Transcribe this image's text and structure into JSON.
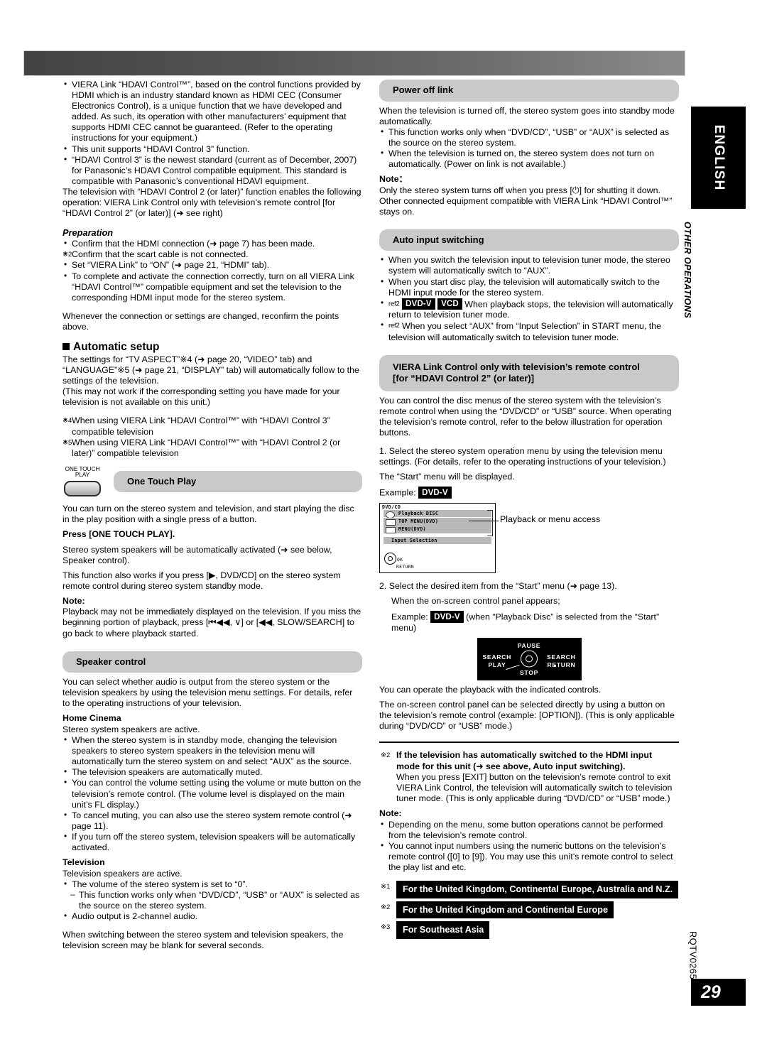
{
  "header": {
    "banner": ""
  },
  "margin": {
    "language_tab": "ENGLISH",
    "section_label": "OTHER OPERATIONS",
    "doc_code": "RQTV0265",
    "page_number": "29"
  },
  "left_column": {
    "intro_bullets": [
      "VIERA Link “HDAVI Control™”, based on the control functions provided by HDMI which is an industry standard known as HDMI CEC (Consumer Electronics Control), is a unique function that we have developed and added. As such, its operation with other manufacturers’ equipment that supports HDMI CEC cannot be guaranteed. (Refer to the operating instructions for your equipment.)",
      "This unit supports “HDAVI Control 3” function."
    ],
    "hdavi3_note": "“HDAVI Control 3” is the newest standard (current as of December, 2007) for Panasonic’s HDAVI Control compatible equipment. This standard is compatible with Panasonic’s conventional HDAVI equipment.",
    "tv_function_para": "The television with “HDAVI Control 2 (or later)” function enables the following operation: VIERA Link Control only with television’s remote control [for “HDAVI Control 2” (or later)] (➜ see right)",
    "preparation_heading": "Preparation",
    "preparation_items": [
      {
        "mark": "bullet",
        "text": "Confirm that the HDMI connection (➜ page 7) has been made."
      },
      {
        "mark": "※2",
        "text": "Confirm that the scart cable is not connected."
      },
      {
        "mark": "bullet",
        "text": "Set “VIERA Link” to “ON” (➜ page 21, “HDMI” tab)."
      },
      {
        "mark": "bullet",
        "text": "To complete and activate the connection correctly, turn on all VIERA Link “HDAVI Control™” compatible equipment and set the television to the corresponding HDMI input mode for the stereo system."
      }
    ],
    "reconfirm_para": "Whenever the connection or settings are changed, reconfirm the points above.",
    "automatic_setup": {
      "heading": "Automatic setup",
      "para1": "The settings for “TV ASPECT”※4 (➜ page 20, “VIDEO” tab) and “LANGUAGE”※5 (➜ page 21, “DISPLAY” tab) will automatically follow to the settings of the television.",
      "para2": "(This may not work if the corresponding setting you have made for your television is not available on this unit.)",
      "footnotes": [
        {
          "mark": "※4",
          "text": "When using VIERA Link “HDAVI Control™” with “HDAVI Control 3” compatible television"
        },
        {
          "mark": "※5",
          "text": "When using VIERA Link “HDAVI Control™” with “HDAVI Control 2 (or later)” compatible television"
        }
      ]
    },
    "one_touch_play": {
      "button_label_line1": "ONE TOUCH",
      "button_label_line2": "PLAY",
      "heading": "One Touch Play",
      "para1": "You can turn on the stereo system and television, and start playing the disc in the play position with a single press of a button.",
      "press_label": "Press [ONE TOUCH PLAY].",
      "para2": "Stereo system speakers will be automatically activated (➜ see below, Speaker control).",
      "para3": "This function also works if you press [▶, DVD/CD] on the stereo system remote control during stereo system standby mode.",
      "note_label": "Note:",
      "note_text": "Playback may not be immediately displayed on the television. If you miss the beginning portion of playback, press [⏮◀◀, ∨] or [◀◀, SLOW/SEARCH] to go back to where playback started."
    },
    "speaker_control": {
      "heading": "Speaker control",
      "intro": "You can select whether audio is output from the stereo system or the television speakers by using the television menu settings. For details, refer to the operating instructions of your television.",
      "home_cinema": {
        "heading": "Home Cinema",
        "lead": "Stereo system speakers are active.",
        "bullets": [
          "When the stereo system is in standby mode, changing the television speakers to stereo system speakers in the television menu will automatically turn the stereo system on and select “AUX” as the source.",
          "The television speakers are automatically muted.",
          "You can control the volume setting using the volume or mute button on the television’s remote control. (The volume level is displayed on the main unit’s FL display.)",
          "To cancel muting, you can also use the stereo system remote control (➜ page 11).",
          "If you turn off the stereo system, television speakers will be automatically activated."
        ]
      },
      "television": {
        "heading": "Television",
        "lead": "Television speakers are active.",
        "bullet1": "The volume of the stereo system is set to “0”.",
        "subbullet1": "This function works only when “DVD/CD”, “USB” or “AUX” is selected as the source on the stereo system.",
        "bullet2": "Audio output is 2-channel audio."
      },
      "closing": "When switching between the stereo system and television speakers, the television screen may be blank for several seconds."
    }
  },
  "right_column": {
    "power_off_link": {
      "heading": "Power off link",
      "intro": "When the television is turned off, the stereo system goes into standby mode automatically.",
      "bullets": [
        "This function works only when “DVD/CD”, “USB” or “AUX” is selected as the source on the stereo system.",
        "When the television is turned on, the stereo system does not turn on automatically. (Power on link is not available.)"
      ],
      "note_label": "Note：",
      "note_text": "Only the stereo system turns off when you press [⏻] for shutting it down. Other connected equipment compatible with VIERA Link “HDAVI Control™” stays on."
    },
    "auto_input_switching": {
      "heading": "Auto input switching",
      "bullets": [
        {
          "mark": "bullet",
          "text": "When you switch the television input to television tuner mode, the stereo system will automatically switch to “AUX”."
        },
        {
          "mark": "bullet",
          "text": "When you start disc play, the television will automatically switch to the HDMI input mode for the stereo system."
        },
        {
          "mark": "ref2",
          "badges": [
            "DVD-V",
            "VCD"
          ],
          "text": "When playback stops, the television will automatically return to television tuner mode."
        },
        {
          "mark": "ref2",
          "text": "When you select “AUX” from “Input Selection” in START menu, the television will automatically switch to television tuner mode."
        }
      ]
    },
    "viera_link_control": {
      "heading_line1": "VIERA Link Control only with television’s remote control",
      "heading_line2": "[for “HDAVI Control 2” (or later)]",
      "intro": "You can control the disc menus of the stereo system with the television’s remote control when using the “DVD/CD” or “USB” source. When operating the television’s remote control, refer to the below illustration for operation buttons.",
      "step1": "1. Select the stereo system operation menu by using the television menu settings. (For details, refer to the operating instructions of your television.)",
      "step1_result": "The “Start” menu will be displayed.",
      "example_label": "Example:",
      "example_badge": "DVD-V",
      "tv_menu": {
        "title": "DVD/CD",
        "rows": [
          {
            "label": "Playback DISC",
            "icon": "disc-icon"
          },
          {
            "label": "TOP MENU(DVD)",
            "icon": "menu-icon"
          },
          {
            "label": "MENU(DVD)",
            "icon": "menu-icon"
          }
        ],
        "extra_row": "Input Selection",
        "footer_line1": "OK",
        "footer_line2": "RETURN"
      },
      "callout": "Playback or menu access",
      "step2": "2. Select the desired item from the “Start” menu (➜ page 13).",
      "step2_sub": "When the on-screen control panel appears;",
      "step2_example_label": "Example:",
      "step2_example_badge": "DVD-V",
      "step2_example_rest": "(when “Playback Disc” is selected from the “Start” menu)",
      "osd_panel": {
        "pause": "PAUSE",
        "search_left": "SEARCH",
        "search_right": "SEARCH",
        "play": "PLAY",
        "return": "RETURN",
        "stop": "STOP"
      },
      "after1": "You can operate the playback with the indicated controls.",
      "after2": "The on-screen control panel can be selected directly by using a button on the television’s remote control (example: [OPTION]). (This is only applicable during “DVD/CD” or “USB” mode.)"
    },
    "footnote_block": {
      "mark": "※2",
      "bold_line1": "If the television has automatically switched to the HDMI input",
      "bold_line2": "mode for this unit (➜ see above, Auto input switching).",
      "body": "When you press [EXIT] button on the television’s remote control to exit VIERA Link Control, the television will automatically switch to television tuner mode. (This is only applicable during “DVD/CD” or “USB” mode.)",
      "note_label": "Note:",
      "note_bullets": [
        "Depending on the menu, some button operations cannot be performed from the television’s remote control.",
        "You cannot input numbers using the numeric buttons on the television’s remote control ([0] to [9]). You may use this unit’s remote control to select the play list and etc."
      ]
    },
    "region_legend": [
      {
        "mark": "※1",
        "text": "For the United Kingdom, Continental Europe, Australia and N.Z."
      },
      {
        "mark": "※2",
        "text": "For the United Kingdom and Continental Europe"
      },
      {
        "mark": "※3",
        "text": "For Southeast Asia"
      }
    ]
  }
}
